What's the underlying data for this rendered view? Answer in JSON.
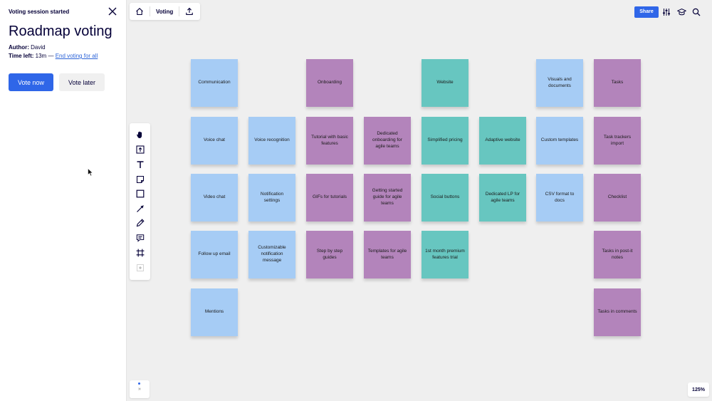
{
  "panel": {
    "header": "Voting session started",
    "title": "Roadmap voting",
    "author_label": "Author:",
    "author": "David",
    "time_label": "Time left:",
    "time_value": "13m —",
    "end_link": "End voting for all",
    "vote_now": "Vote now",
    "vote_later": "Vote later"
  },
  "toolbar": {
    "board_name": "Voting",
    "share_label": "Share"
  },
  "zoom_level": "125%",
  "bottom_left_label": "»",
  "colors": {
    "blue": "#a6ccf5",
    "purple": "#b384bb",
    "teal": "#67c6c0",
    "accent": "#2f66e8"
  },
  "notes": {
    "r0": [
      "Communication",
      "Onboarding",
      "Website",
      "Visuals and documents",
      "Tasks"
    ],
    "r1": [
      "Voice chat",
      "Voice recognition",
      "Tutorial with basic features",
      "Dedicated onboarding for agile teams",
      "Simplified pricing",
      "Adaptive website",
      "Custom templates",
      "Task trackers import"
    ],
    "r2": [
      "Video chat",
      "Notification settings",
      "GIFs for tutorials",
      "Getting started guide for agile teams",
      "Social buttons",
      "Dedicated LP for agile teams",
      "CSV format to docs",
      "Checklist"
    ],
    "r3": [
      "Follow up email",
      "Customizable notification message",
      "Step by step guides",
      "Templates for agile teams",
      "1st month premium features trial",
      "Tasks in post-it notes"
    ],
    "r4": [
      "Mentions",
      "Tasks in comments"
    ]
  }
}
